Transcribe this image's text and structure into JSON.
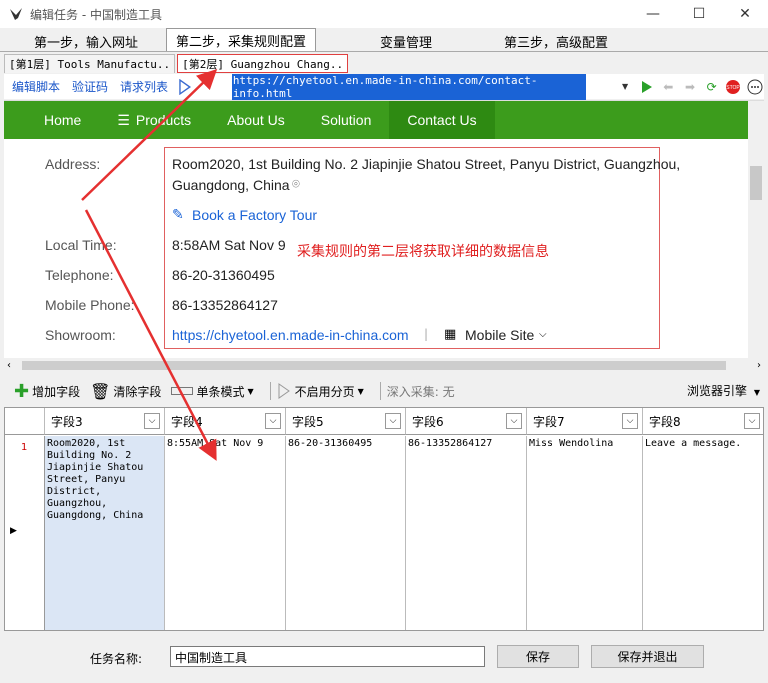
{
  "window": {
    "title": "编辑任务 - 中国制造工具"
  },
  "step_tabs": [
    "第一步，输入网址",
    "第二步，采集规则配置",
    "变量管理",
    "第三步，高级配置"
  ],
  "layer_tabs": [
    "[第1层] Tools Manufactu..",
    "[第2层] Guangzhou Chang.."
  ],
  "toolbar": {
    "links": [
      "编辑脚本",
      "验证码",
      "请求列表"
    ],
    "url": "https://chyetool.en.made-in-china.com/contact-info.html"
  },
  "site_nav": [
    "Home",
    "Products",
    "About Us",
    "Solution",
    "Contact Us"
  ],
  "contact": {
    "address_label": "Address:",
    "address_line1": "Room2020, 1st Building No. 2 Jiapinjie Shatou Street, Panyu District, Guangzhou,",
    "address_line2": "Guangdong, China",
    "factory_tour": "Book a Factory Tour",
    "local_time_label": "Local Time:",
    "local_time": "8:58AM Sat Nov 9",
    "telephone_label": "Telephone:",
    "telephone": "86-20-31360495",
    "mobile_label": "Mobile Phone:",
    "mobile": "86-13352864127",
    "showroom_label": "Showroom:",
    "showroom": "https://chyetool.en.made-in-china.com",
    "mobile_site": "Mobile Site"
  },
  "annotation": "采集规则的第二层将获取详细的数据信息",
  "field_toolbar": {
    "add": "增加字段",
    "clear": "清除字段",
    "mode": "单条模式",
    "paging": "不启用分页",
    "deep": "深入采集: 无",
    "engine": "浏览器引擎"
  },
  "grid": {
    "headers": [
      "字段3",
      "字段4",
      "字段5",
      "字段6",
      "字段7",
      "字段8"
    ],
    "row_num": "1",
    "row": [
      "Room2020, 1st Building No. 2 Jiapinjie Shatou Street, Panyu District, Guangzhou, Guangdong, China",
      "8:55AM Sat Nov 9",
      "86-20-31360495",
      "86-13352864127",
      "Miss Wendolina",
      "Leave a message."
    ]
  },
  "bottom": {
    "task_label": "任务名称:",
    "task_name": "中国制造工具",
    "save": "保存",
    "save_exit": "保存并退出"
  },
  "colors": {
    "nav_green": "#3c9c1c",
    "annotation_red": "#e02020",
    "link_blue": "#1a56c9"
  }
}
